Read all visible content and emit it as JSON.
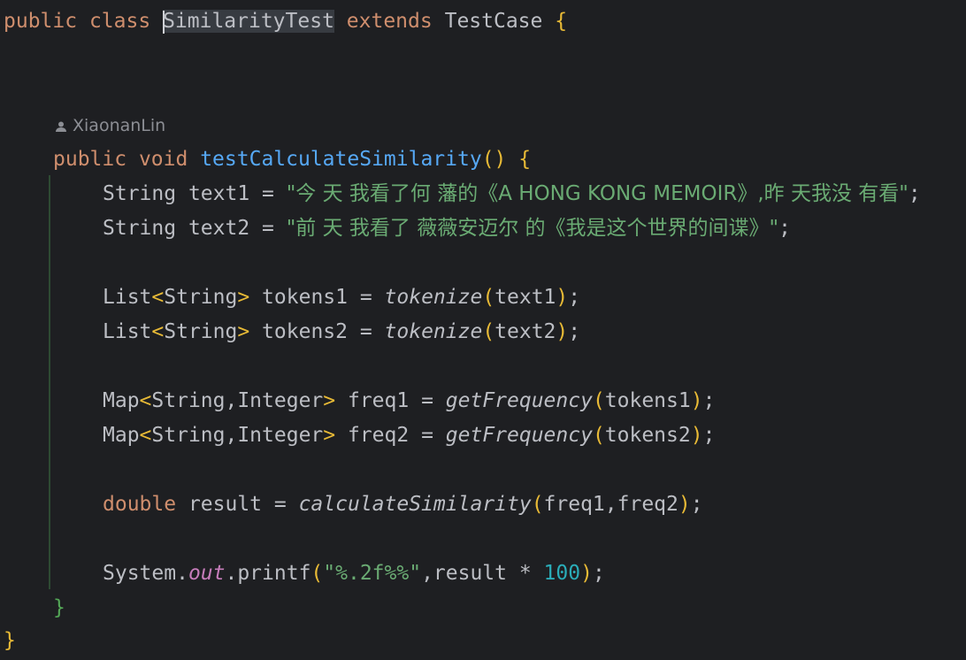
{
  "editor": {
    "class_decl": {
      "kw1": "public",
      "kw2": "class",
      "name": "SimilarityTest",
      "kw3": "extends",
      "parent": "TestCase",
      "brace": "{"
    },
    "author": "XiaonanLin",
    "method": {
      "kw1": "public",
      "kw2": "void",
      "name": "testCalculateSimilarity",
      "parens": "()",
      "brace": "{"
    },
    "line_text1": {
      "type": "String",
      "var": " text1 = ",
      "value": "\"今 天 我看了何 藩的《A HONG KONG MEMOIR》,昨 天我没 有看\"",
      "end": ";"
    },
    "line_text2": {
      "type": "String",
      "var": " text2 = ",
      "value": "\"前 天 我看了 薇薇安迈尔 的《我是这个世界的间谍》\"",
      "end": ";"
    },
    "line_tokens1": {
      "type": "List",
      "generic": "<",
      "gtype": "String",
      "gclose": ">",
      "var": " tokens1 = ",
      "call": "tokenize",
      "open": "(",
      "arg": "text1",
      "close": ")",
      "end": ";"
    },
    "line_tokens2": {
      "type": "List",
      "generic": "<",
      "gtype": "String",
      "gclose": ">",
      "var": " tokens2 = ",
      "call": "tokenize",
      "open": "(",
      "arg": "text2",
      "close": ")",
      "end": ";"
    },
    "line_freq1": {
      "type": "Map",
      "generic": "<",
      "gtype": "String,Integer",
      "gclose": ">",
      "var": " freq1 = ",
      "call": "getFrequency",
      "open": "(",
      "arg": "tokens1",
      "close": ")",
      "end": ";"
    },
    "line_freq2": {
      "type": "Map",
      "generic": "<",
      "gtype": "String,Integer",
      "gclose": ">",
      "var": " freq2 = ",
      "call": "getFrequency",
      "open": "(",
      "arg": "tokens2",
      "close": ")",
      "end": ";"
    },
    "line_result": {
      "kw": "double",
      "var": " result = ",
      "call": "calculateSimilarity",
      "open": "(",
      "arg": "freq1,freq2",
      "close": ")",
      "end": ";"
    },
    "line_print": {
      "obj": "System.",
      "field": "out",
      "method": ".printf",
      "open": "(",
      "fmt": "\"%.2f%%\"",
      "arg": ",result * ",
      "num": "100",
      "close": ")",
      "end": ";"
    },
    "method_close": "}",
    "class_close": "}"
  },
  "colors": {
    "background": "#1e1f22",
    "keyword": "#cf8e6d",
    "function": "#56a8f5",
    "string": "#6aab73",
    "field": "#c77dbb",
    "number": "#2aacb8"
  }
}
